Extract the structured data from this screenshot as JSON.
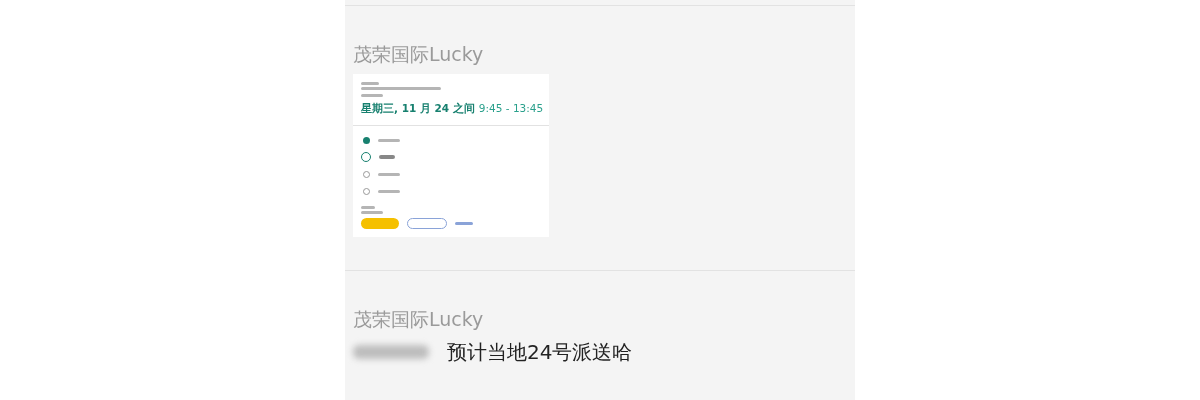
{
  "messages": [
    {
      "sender": "茂荣国际Lucky",
      "kind": "image",
      "image": {
        "date_heading": "星期三, 11 月 24 之间",
        "time_range": "9:45 - 13:45",
        "steps": [
          {
            "done": true,
            "current": false
          },
          {
            "done": false,
            "current": true
          },
          {
            "done": false,
            "current": false
          },
          {
            "done": false,
            "current": false
          }
        ]
      }
    },
    {
      "sender": "茂荣国际Lucky",
      "kind": "text",
      "text": "预计当地24号派送哈"
    }
  ]
}
